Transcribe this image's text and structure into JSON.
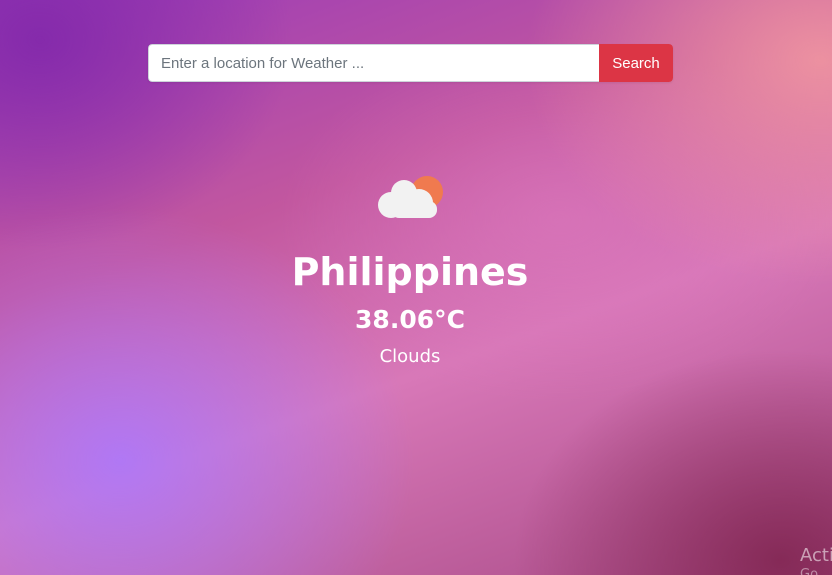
{
  "search": {
    "placeholder": "Enter a location for Weather ...",
    "value": "",
    "button_label": "Search",
    "button_color": "#dc3545"
  },
  "weather": {
    "icon": "partly-cloudy-icon",
    "city": "Philippines",
    "temperature": "38.06°C",
    "description": "Clouds"
  },
  "watermark": {
    "text": "Acti",
    "subtext": "Go"
  },
  "colors": {
    "text": "#ffffff",
    "sun": "#f07a4f",
    "cloud": "#f2f2f2"
  }
}
